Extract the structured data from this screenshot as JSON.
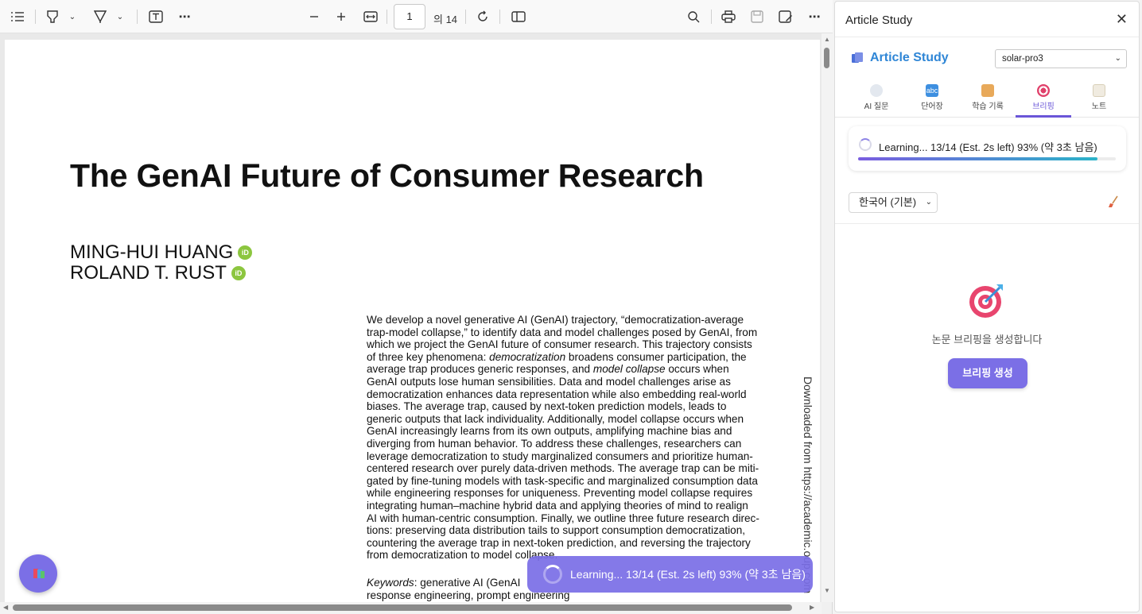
{
  "toolbar": {
    "page_number": "1",
    "page_total_label": "의 14"
  },
  "paper": {
    "title": "The GenAI Future of Consumer Research",
    "authors": [
      "MING-HUI HUANG",
      "ROLAND T. RUST"
    ],
    "orcid_label": "iD",
    "abstract_lines": [
      "We develop a novel generative AI (GenAI) trajectory, “democratization-average",
      "trap-model collapse,” to identify data and model challenges posed by GenAI, from",
      "which we project the GenAI future of consumer research. This trajectory consists",
      "of three key phenomena: democratization broadens consumer participation, the",
      "average trap produces generic responses, and model collapse occurs when",
      "GenAI outputs lose human sensibilities. Data and model challenges arise as",
      "democratization enhances data representation while also embedding real-world",
      "biases. The average trap, caused by next-token prediction models, leads to",
      "generic outputs that lack individuality. Additionally, model collapse occurs when",
      "GenAI increasingly learns from its own outputs, amplifying machine bias and",
      "diverging from human behavior. To address these challenges, researchers can",
      "leverage democratization to study marginalized consumers and prioritize human-",
      "centered research over purely data-driven methods. The average trap can be miti-",
      "gated by fine-tuning models with task-specific and marginalized consumption data",
      "while engineering responses for uniqueness. Preventing model collapse requires",
      "integrating human–machine hybrid data and applying theories of mind to realign",
      "AI with human-centric consumption. Finally, we outline three future research direc-",
      "tions: preserving data distribution tails to support consumption democratization,",
      "countering the average trap in next-token prediction, and reversing the trajectory",
      "from democratization to model collapse."
    ],
    "keywords_label": "Keywords",
    "keywords_text": ": generative AI (GenAI",
    "keywords_line2": "response engineering, prompt engineering",
    "side_text": "Downloaded from https://academic.oup.com"
  },
  "toast": {
    "text": "Learning... 13/14 (Est. 2s left) 93% (약 3초 남음)"
  },
  "panel": {
    "header_title": "Article Study",
    "brand_title": "Article Study",
    "model_selected": "solar-pro3",
    "tabs": [
      {
        "label": "AI 질문",
        "icon": "chat-bubble-icon",
        "color": "#c9d3e0"
      },
      {
        "label": "단어장",
        "icon": "abc-icon",
        "color": "#3d8fe0"
      },
      {
        "label": "학습 기록",
        "icon": "scroll-icon",
        "color": "#e8a95a"
      },
      {
        "label": "브리핑",
        "icon": "target-icon",
        "color": "#e0406a"
      },
      {
        "label": "노트",
        "icon": "memo-icon",
        "color": "#e8e0d0"
      }
    ],
    "active_tab": 3,
    "progress_text": "Learning... 13/14 (Est. 2s left) 93% (약 3초 남음)",
    "progress_fraction": 0.93,
    "language_selected": "한국어 (기본)",
    "empty_message": "논문 브리핑을 생성합니다",
    "generate_button": "브리핑 생성",
    "accent_color": "#7b6fe6",
    "brand_color": "#2f86d6"
  }
}
